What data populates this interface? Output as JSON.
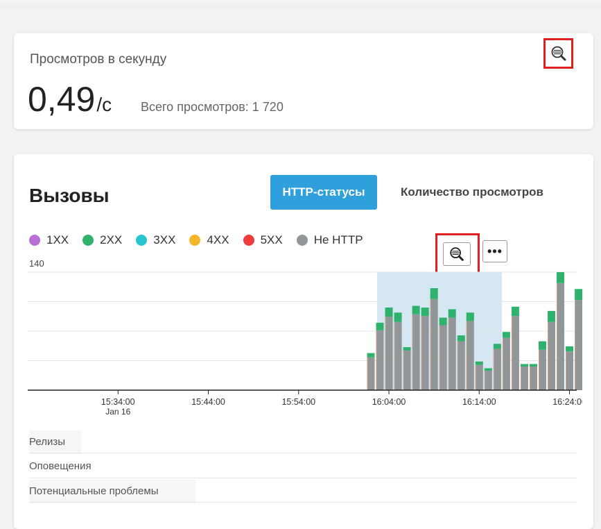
{
  "views_card": {
    "title": "Просмотров в секунду",
    "value": "0,49",
    "unit": "/с",
    "total": "Всего просмотров: 1 720",
    "zoom_icon": "zoom-search-icon"
  },
  "calls_card": {
    "title": "Вызовы",
    "tabs": [
      {
        "label": "HTTP-статусы",
        "active": true
      },
      {
        "label": "Количество просмотров",
        "active": false
      }
    ],
    "legend": [
      {
        "label": "1XX",
        "color": "#b76fd6"
      },
      {
        "label": "2XX",
        "color": "#2fb36c"
      },
      {
        "label": "3XX",
        "color": "#28c4cf"
      },
      {
        "label": "4XX",
        "color": "#f5b52a"
      },
      {
        "label": "5XX",
        "color": "#ee3c3c"
      },
      {
        "label": "Не HTTP",
        "color": "#919799"
      }
    ],
    "more_label": "•••",
    "lanes": [
      "Релизы",
      "Оповещения",
      "Потенциальные проблемы"
    ]
  },
  "chart_data": {
    "type": "bar",
    "stacked": true,
    "y_max_label": "140",
    "ylim": [
      0,
      140
    ],
    "x_ticks": [
      {
        "label": "15:34:00",
        "sub": "Jan 16",
        "min": 9.5
      },
      {
        "label": "15:44:00",
        "sub": "",
        "min": 19.5
      },
      {
        "label": "15:54:00",
        "sub": "",
        "min": 29.5
      },
      {
        "label": "16:04:00",
        "sub": "",
        "min": 39.5
      },
      {
        "label": "16:14:00",
        "sub": "",
        "min": 49.5
      },
      {
        "label": "16:24:00",
        "sub": "",
        "min": 59.5
      }
    ],
    "x_range_min": [
      -0.5,
      60.3
    ],
    "selection_min": [
      38.2,
      52.0
    ],
    "x_min_start": 37,
    "series": [
      {
        "name": "Не HTTP",
        "color": "#919799",
        "values": [
          39,
          71,
          87,
          81,
          47,
          90,
          88,
          108,
          77,
          86,
          58,
          82,
          30,
          23,
          49,
          62,
          88,
          28,
          28,
          48,
          81,
          127,
          46,
          107
        ]
      },
      {
        "name": "2XX",
        "color": "#2fb36c",
        "values": [
          5,
          9,
          11,
          11,
          4,
          10,
          10,
          13,
          9,
          10,
          7,
          10,
          4,
          3,
          6,
          7,
          11,
          3,
          3,
          10,
          13,
          13,
          6,
          13
        ]
      }
    ],
    "grid_lines": [
      35,
      70,
      105,
      140
    ]
  }
}
